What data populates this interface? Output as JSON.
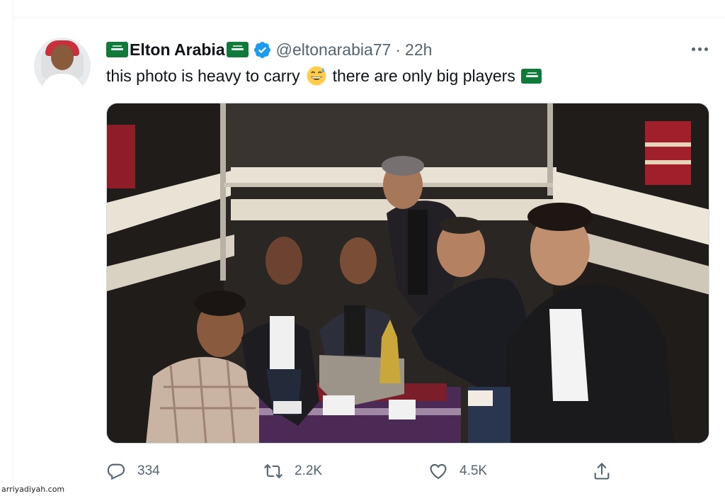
{
  "tweet": {
    "display_name": "Elton Arabia",
    "handle": "@eltonarabia77",
    "separator": "·",
    "time": "22h",
    "text_before_emoji": "this photo is heavy to carry",
    "text_after_emoji": "there are only big players",
    "emoji": "grinning-face-with-sweat-icon",
    "flag_icon": "saudi-flag-icon",
    "verified_icon": "verified-badge-icon",
    "verified_color": "#1d9bf0"
  },
  "stats": {
    "replies": "334",
    "retweets": "2.2K",
    "likes": "4.5K"
  },
  "media": {
    "icon": "group-photo"
  },
  "watermark": "arriyadiyah.com",
  "colors": {
    "text": "#0f1419",
    "secondary": "#536471",
    "flag_green": "#0f7a3a"
  }
}
